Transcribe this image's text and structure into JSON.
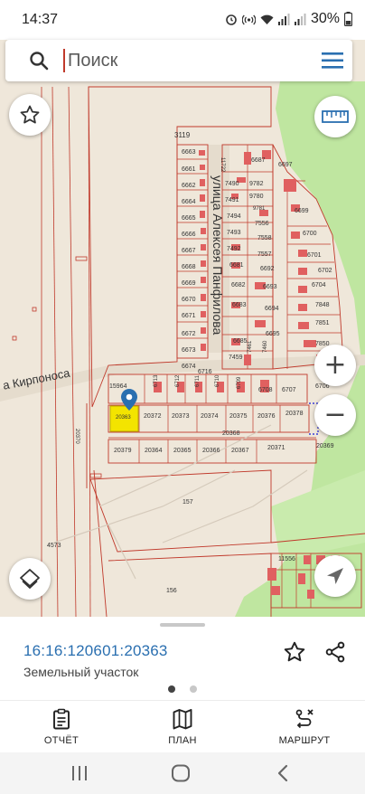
{
  "status_bar": {
    "time": "14:37",
    "battery": "30%"
  },
  "search": {
    "placeholder": "Поиск"
  },
  "map": {
    "street_labels": [
      "улица Алексея Панфилова",
      "а Кирпоноса"
    ],
    "parcel_labels": [
      "3119",
      "6663",
      "6661",
      "6662",
      "6664",
      "6665",
      "6666",
      "6667",
      "6668",
      "6669",
      "6670",
      "6671",
      "6672",
      "6673",
      "6674",
      "6687",
      "6697",
      "11722",
      "7490",
      "9782",
      "7491",
      "9780",
      "9781",
      "7494",
      "7493",
      "7556",
      "7558",
      "7492",
      "7557",
      "6681",
      "6692",
      "6682",
      "6693",
      "6683",
      "6694",
      "6685",
      "6695",
      "7459",
      "7461",
      "7460",
      "6699",
      "6700",
      "6701",
      "6702",
      "6704",
      "7848",
      "7851",
      "7850",
      "6706",
      "6716",
      "15964",
      "6713",
      "6712",
      "6711",
      "6710",
      "6709",
      "6708",
      "6707",
      "20363",
      "20372",
      "20373",
      "20374",
      "20375",
      "20376",
      "20378",
      "20368",
      "20369",
      "20370",
      "20379",
      "20364",
      "20365",
      "20366",
      "20367",
      "20371",
      "157",
      "156",
      "4573",
      "11556"
    ],
    "selected_parcel": "20363",
    "colors": {
      "background": "#efe7da",
      "parcel_line": "#c0392b",
      "building": "#e06060",
      "forest": "#bfe6a0",
      "selected_fill": "#f3e400",
      "road": "#d8d2c6",
      "marker": "#2a6fb0"
    }
  },
  "map_controls": {
    "favorite_icon": "star-outline-icon",
    "ruler_icon": "ruler-icon",
    "zoom_in": "+",
    "zoom_out": "−",
    "layers_icon": "layers-icon",
    "locate_icon": "navigation-arrow-icon"
  },
  "sheet": {
    "parcel_number": "16:16:120601:20363",
    "parcel_type": "Земельный участок",
    "favorite_icon": "star-outline-icon",
    "share_icon": "share-icon",
    "page_dots": 2,
    "active_dot": 0
  },
  "bottom_nav": {
    "items": [
      {
        "label": "ОТЧЁТ",
        "icon": "clipboard-icon"
      },
      {
        "label": "ПЛАН",
        "icon": "map-plan-icon"
      },
      {
        "label": "МАРШРУТ",
        "icon": "route-icon"
      }
    ]
  },
  "system_nav": {
    "recents_icon": "recents-icon",
    "home_icon": "home-icon",
    "back_icon": "back-icon"
  }
}
